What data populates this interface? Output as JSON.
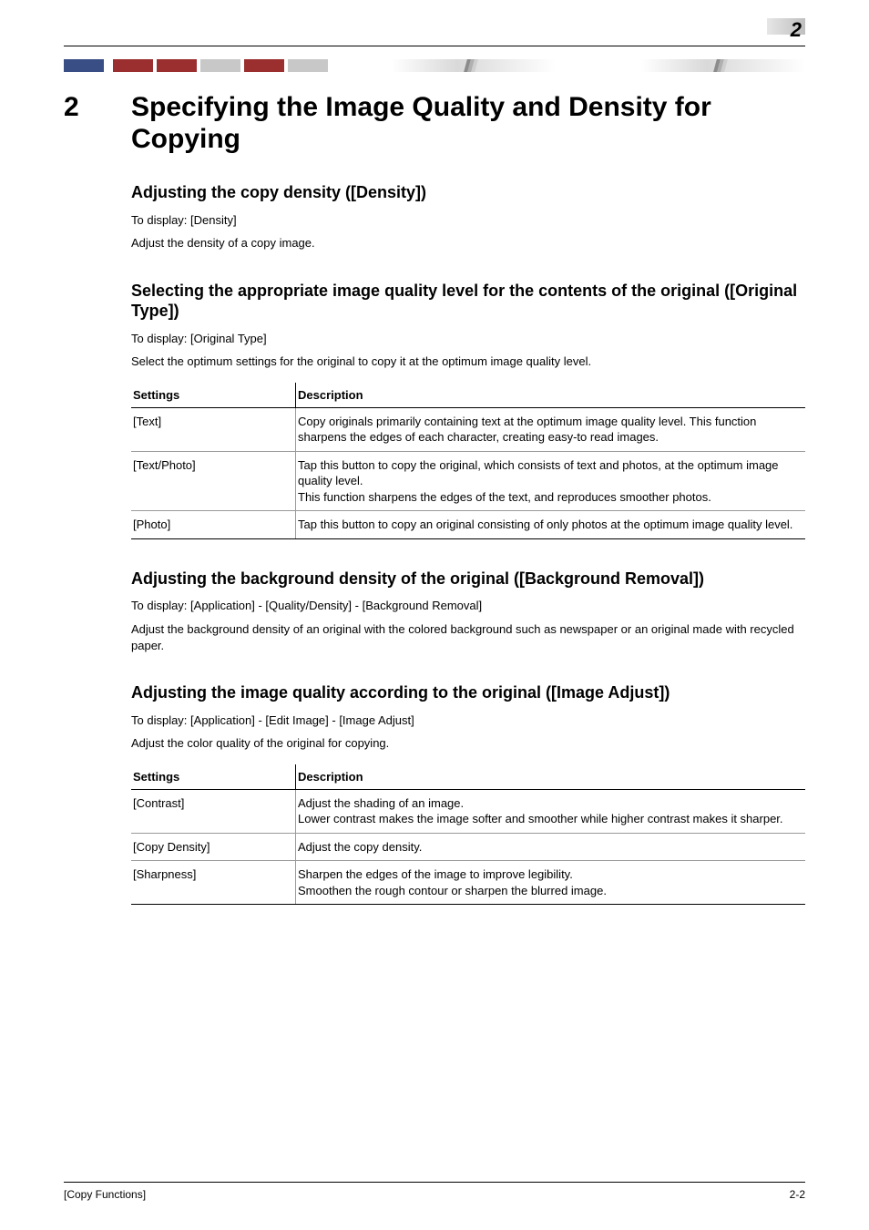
{
  "header": {
    "corner_number": "2"
  },
  "chapter": {
    "number": "2",
    "title": "Specifying the Image Quality and Density for Copying"
  },
  "sections": {
    "density": {
      "heading": "Adjusting the copy density ([Density])",
      "to_display": "To display: [Density]",
      "body": "Adjust the density of a copy image."
    },
    "original_type": {
      "heading": "Selecting the appropriate image quality level for the contents of the original ([Original Type])",
      "to_display": "To display: [Original Type]",
      "body": "Select the optimum settings for the original to copy it at the optimum image quality level.",
      "table": {
        "headers": [
          "Settings",
          "Description"
        ],
        "rows": [
          {
            "setting": "[Text]",
            "description": "Copy originals primarily containing text at the optimum image quality level. This function sharpens the edges of each character, creating easy-to read images."
          },
          {
            "setting": "[Text/Photo]",
            "description": "Tap this button to copy the original, which consists of text and photos, at the optimum image quality level.\nThis function sharpens the edges of the text, and reproduces smoother photos."
          },
          {
            "setting": "[Photo]",
            "description": "Tap this button to copy an original consisting of only photos at the optimum image quality level."
          }
        ]
      }
    },
    "background_removal": {
      "heading": "Adjusting the background density of the original ([Background Removal])",
      "to_display": "To display: [Application] - [Quality/Density] - [Background Removal]",
      "body": "Adjust the background density of an original with the colored background such as newspaper or an original made with recycled paper."
    },
    "image_adjust": {
      "heading": "Adjusting the image quality according to the original ([Image Adjust])",
      "to_display": "To display: [Application] - [Edit Image] - [Image Adjust]",
      "body": "Adjust the color quality of the original for copying.",
      "table": {
        "headers": [
          "Settings",
          "Description"
        ],
        "rows": [
          {
            "setting": "[Contrast]",
            "description": "Adjust the shading of an image.\nLower contrast makes the image softer and smoother while higher contrast makes it sharper."
          },
          {
            "setting": "[Copy Density]",
            "description": "Adjust the copy density."
          },
          {
            "setting": "[Sharpness]",
            "description": "Sharpen the edges of the image to improve legibility.\nSmoothen the rough contour or sharpen the blurred image."
          }
        ]
      }
    }
  },
  "footer": {
    "left": "[Copy Functions]",
    "right": "2-2"
  }
}
